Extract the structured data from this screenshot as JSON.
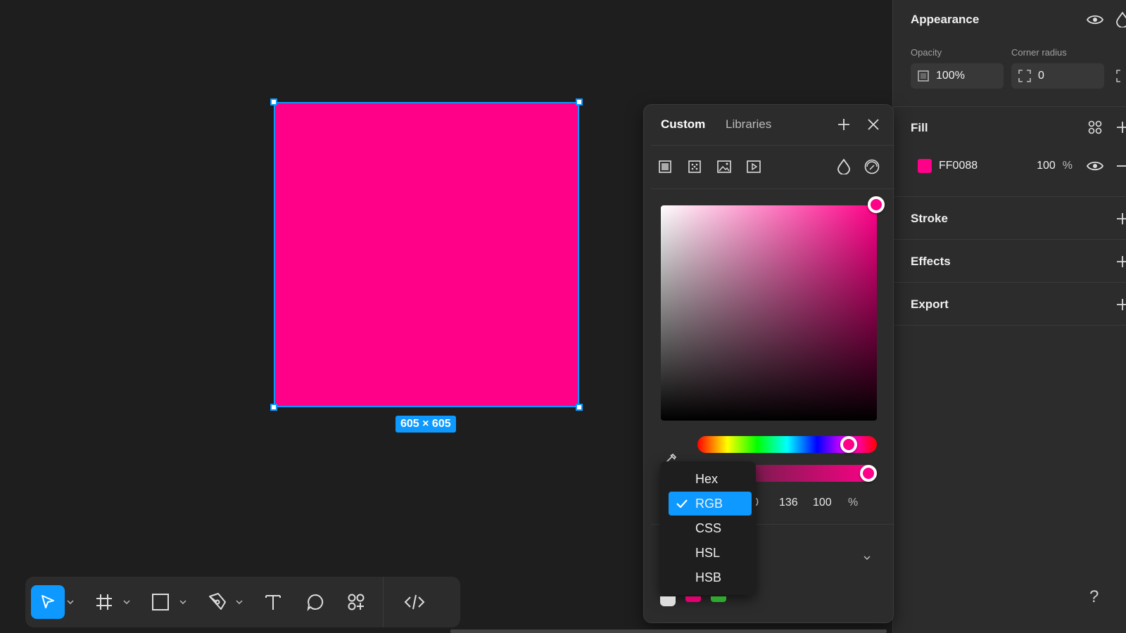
{
  "colors": {
    "accent": "#0d99ff",
    "fill": "#ff0088",
    "background": "#1e1e1e",
    "panel": "#2c2c2c"
  },
  "canvas": {
    "size_badge": "605 × 605"
  },
  "toolbar": {
    "tools": [
      "move-tool",
      "frame-tool",
      "rectangle-tool",
      "pen-tool",
      "text-tool",
      "comment-tool",
      "actions-tool",
      "dev-mode-tool"
    ]
  },
  "picker": {
    "tab_custom": "Custom",
    "tab_libraries": "Libraries",
    "values": [
      "0",
      "136",
      "100"
    ],
    "percent": "%",
    "format_options": [
      "Hex",
      "RGB",
      "CSS",
      "HSL",
      "HSB"
    ],
    "selected_format": "RGB",
    "hue_value": 0.88,
    "alpha_value": 1.0
  },
  "panel": {
    "appearance": {
      "title": "Appearance",
      "opacity_label": "Opacity",
      "opacity_value": "100%",
      "radius_label": "Corner radius",
      "radius_value": "0"
    },
    "fill": {
      "title": "Fill",
      "hex": "FF0088",
      "opacity": "100",
      "percent": "%"
    },
    "stroke_title": "Stroke",
    "effects_title": "Effects",
    "export_title": "Export"
  },
  "help_label": "?"
}
